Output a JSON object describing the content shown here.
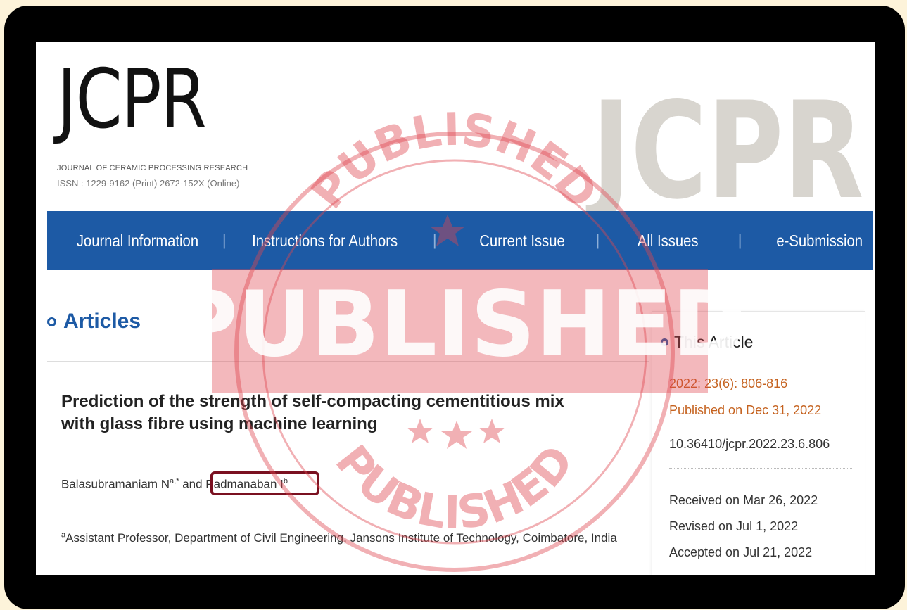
{
  "logo": {
    "text": "JCPR",
    "watermark": "JCPR"
  },
  "journal": {
    "name": "JOURNAL OF CERAMIC PROCESSING RESEARCH",
    "issn": "ISSN : 1229-9162 (Print)   2672-152X (Online)"
  },
  "nav": {
    "items": [
      "Journal Information",
      "Instructions for Authors",
      "Current Issue",
      "All Issues",
      "e-Submission"
    ],
    "separator": "|"
  },
  "section": {
    "title": "Articles"
  },
  "article": {
    "title_line1": "Prediction of the strength of self-compacting cementitious mix",
    "title_line2": "with glass fibre using machine learning",
    "author1": "Balasubramaniam N",
    "author1_sup": "a,*",
    "conj": " and ",
    "author2": "Padmanaban I",
    "author2_sup": "b",
    "affiliation_sup": "a",
    "affiliation": "Assistant Professor, Department of Civil Engineering, Jansons Institute of Technology, Coimbatore, India"
  },
  "sidebar": {
    "title": "This Article",
    "volume": "2022; 23(6): 806-816",
    "published": "Published on Dec 31, 2022",
    "doi": "10.36410/jcpr.2022.23.6.806",
    "received": "Received on Mar 26, 2022",
    "revised": "Revised on Jul 1, 2022",
    "accepted": "Accepted on Jul 21, 2022"
  },
  "stamp": {
    "banner": "PUBLISHED",
    "arc_top": "PUBLISHED",
    "arc_bottom": "PUBLISHED",
    "color": "#e0454f"
  },
  "colors": {
    "nav_bg": "#1d5aa5",
    "accent_orange": "#c5621f",
    "highlight_border": "#7a1020"
  }
}
